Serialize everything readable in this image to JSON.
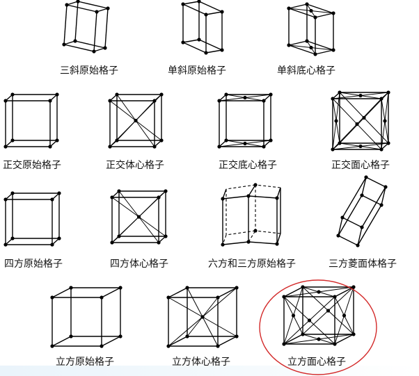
{
  "lattices": [
    {
      "id": "triclinic-primitive",
      "label": "三斜原始格子"
    },
    {
      "id": "monoclinic-primitive",
      "label": "单斜原始格子"
    },
    {
      "id": "monoclinic-base-centered",
      "label": "单斜底心格子"
    },
    {
      "id": "orthorhombic-primitive",
      "label": "正交原始格子"
    },
    {
      "id": "orthorhombic-body-centered",
      "label": "正交体心格子"
    },
    {
      "id": "orthorhombic-base-centered",
      "label": "正交底心格子"
    },
    {
      "id": "orthorhombic-face-centered",
      "label": "正交面心格子"
    },
    {
      "id": "tetragonal-primitive",
      "label": "四方原始格子"
    },
    {
      "id": "tetragonal-body-centered",
      "label": "四方体心格子"
    },
    {
      "id": "hexagonal-trigonal-primitive",
      "label": "六方和三方原始格子"
    },
    {
      "id": "trigonal-rhombohedral",
      "label": "三方菱面体格子"
    },
    {
      "id": "cubic-primitive",
      "label": "立方原始格子"
    },
    {
      "id": "cubic-body-centered",
      "label": "立方体心格子"
    },
    {
      "id": "cubic-face-centered",
      "label": "立方面心格子"
    }
  ],
  "highlight": {
    "target": "cubic-face-centered",
    "color": "#d32a2a"
  },
  "colors": {
    "background": "#ffffff",
    "lines": "#000000",
    "band": "#eaf4fb"
  }
}
